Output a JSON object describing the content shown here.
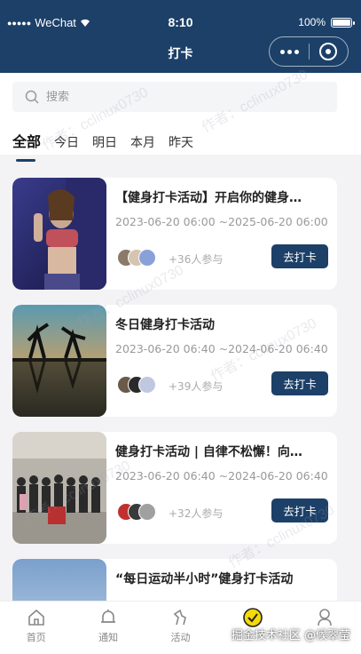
{
  "status_bar": {
    "carrier": "WeChat",
    "time": "8:10",
    "battery": "100%",
    "battery_level": 1.0
  },
  "nav": {
    "title": "打卡"
  },
  "search": {
    "placeholder": "搜索"
  },
  "tabs": [
    {
      "label": "全部",
      "active": true
    },
    {
      "label": "今日",
      "active": false
    },
    {
      "label": "明日",
      "active": false
    },
    {
      "label": "本月",
      "active": false
    },
    {
      "label": "昨天",
      "active": false
    }
  ],
  "cards": [
    {
      "title": "【健身打卡活动】开启你的健身…",
      "time": "2023-06-20 06:00 ~2025-06-20 06:00",
      "participants": "+36人参与",
      "button": "去打卡"
    },
    {
      "title": "冬日健身打卡活动",
      "time": "2023-06-20 06:40 ~2024-06-20 06:40",
      "participants": "+39人参与",
      "button": "去打卡"
    },
    {
      "title": "健身打卡活动 | 自律不松懈！向…",
      "time": "2023-06-20 06:40 ~2024-06-20 06:40",
      "participants": "+32人参与",
      "button": "去打卡"
    },
    {
      "title": "“每日运动半小时”健身打卡活动",
      "time": "",
      "participants": "",
      "button": ""
    }
  ],
  "tabbar": [
    {
      "label": "首页",
      "icon": "home-icon"
    },
    {
      "label": "通知",
      "icon": "bell-icon"
    },
    {
      "label": "活动",
      "icon": "activity-icon"
    },
    {
      "label": "",
      "icon": "checkin-icon"
    },
    {
      "label": "",
      "icon": "profile-icon"
    }
  ],
  "credit": "掘金技术社区 @候翠莹",
  "watermark": "作者：cclinux0730",
  "colors": {
    "primary": "#1c4068",
    "accent": "#f5d90a"
  }
}
